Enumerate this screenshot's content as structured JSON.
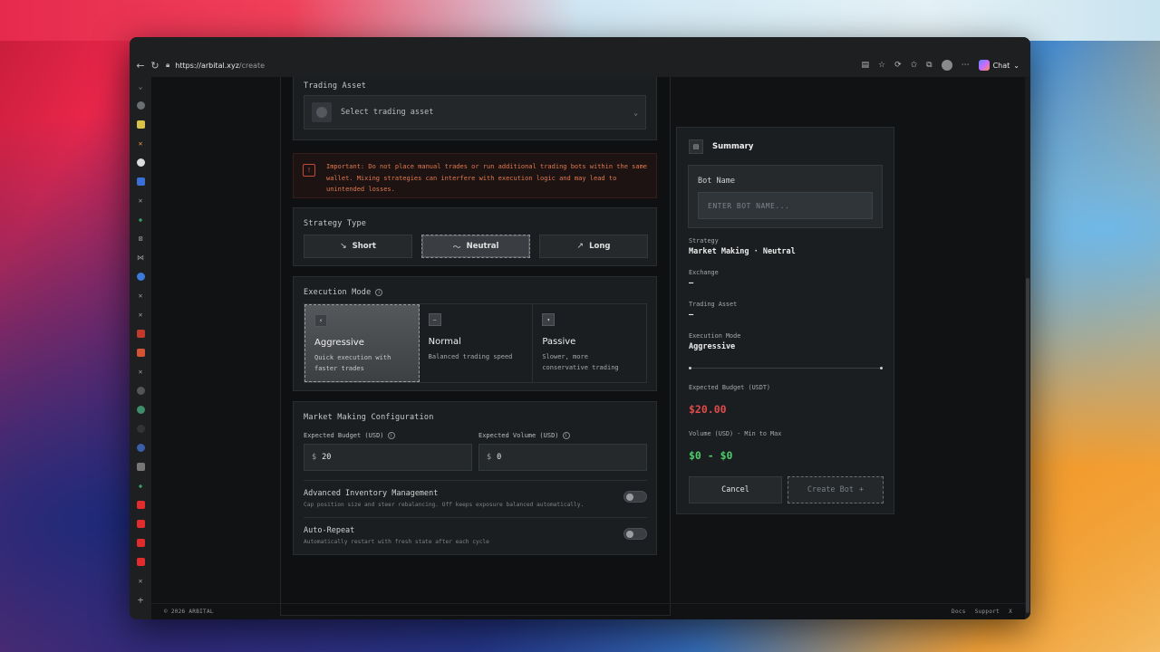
{
  "browser": {
    "url_host": "https://arbital.xyz",
    "url_path": "/create",
    "chat_label": "Chat"
  },
  "form": {
    "trading_asset": {
      "label": "Trading Asset",
      "placeholder": "Select trading asset"
    },
    "warning": "Important: Do not place manual trades or run additional trading bots within the same wallet. Mixing strategies can interfere with execution logic and may lead to unintended losses.",
    "strategy_type": {
      "label": "Strategy Type",
      "options": [
        {
          "label": "Short",
          "icon": "trend-down-icon",
          "glyph": "↘"
        },
        {
          "label": "Neutral",
          "icon": "wave-icon",
          "glyph": "〜"
        },
        {
          "label": "Long",
          "icon": "trend-up-icon",
          "glyph": "↗"
        }
      ],
      "selected": "Neutral"
    },
    "execution_mode": {
      "label": "Execution Mode",
      "modes": [
        {
          "title": "Aggressive",
          "desc": "Quick execution with faster trades",
          "glyph": "⚡"
        },
        {
          "title": "Normal",
          "desc": "Balanced trading speed",
          "glyph": "–"
        },
        {
          "title": "Passive",
          "desc": "Slower, more conservative trading",
          "glyph": "▾"
        }
      ],
      "selected": "Aggressive"
    },
    "mm_config": {
      "label": "Market Making Configuration",
      "budget_label": "Expected Budget (USD)",
      "budget_currency": "$",
      "budget_value": "20",
      "volume_label": "Expected Volume (USD)",
      "volume_currency": "$",
      "volume_value": "0"
    },
    "advanced_inventory": {
      "title": "Advanced Inventory Management",
      "desc": "Cap position size and steer rebalancing. Off keeps exposure balanced automatically.",
      "enabled": false
    },
    "auto_repeat": {
      "title": "Auto-Repeat",
      "desc": "Automatically restart with fresh state after each cycle",
      "enabled": false
    }
  },
  "summary": {
    "title": "Summary",
    "bot_name_label": "Bot Name",
    "bot_name_placeholder": "ENTER BOT NAME...",
    "strategy_label": "Strategy",
    "strategy_value": "Market Making · Neutral",
    "exchange_label": "Exchange",
    "exchange_value": "—",
    "asset_label": "Trading Asset",
    "asset_value": "—",
    "mode_label": "Execution Mode",
    "mode_value": "Aggressive",
    "budget_label": "Expected Budget (USDT)",
    "budget_value": "$20.00",
    "volume_label": "Volume (USD) - Min to Max",
    "volume_value": "$0 - $0",
    "cancel_label": "Cancel",
    "create_label": "Create Bot"
  },
  "footer": {
    "copyright": "© 2026 ARBITAL",
    "links": [
      "Docs",
      "Support",
      "X"
    ]
  },
  "colors": {
    "accent_red": "#e14a4a",
    "accent_green": "#4ecb6a",
    "warning_text": "#e07a4c"
  }
}
